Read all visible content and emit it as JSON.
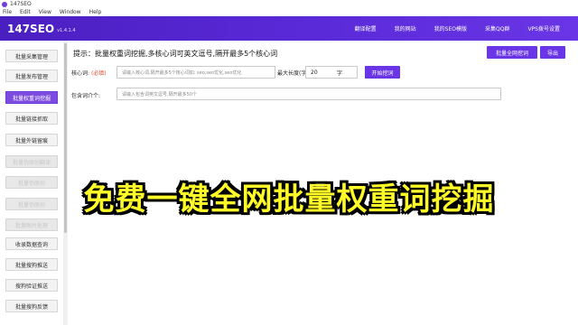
{
  "window": {
    "title": "147SEO"
  },
  "menu": [
    "File",
    "Edit",
    "View",
    "Window",
    "Help"
  ],
  "header": {
    "brand": "147SEO",
    "version": "v1.4.1.4",
    "nav": [
      "翻译配置",
      "我的网站",
      "我的SEO模版",
      "采集QQ群",
      "VPS拨号设置"
    ]
  },
  "sidebar": {
    "items": [
      {
        "label": "批量采集管理",
        "state": "normal"
      },
      {
        "label": "批量发布管理",
        "state": "normal"
      },
      {
        "label": "批量权重词挖掘",
        "state": "active"
      },
      {
        "label": "批量链接抓取",
        "state": "normal"
      },
      {
        "label": "批量外链留痕",
        "state": "normal"
      },
      {
        "label": "批量伪原创翻译",
        "state": "disabled"
      },
      {
        "label": "批量伪原创",
        "state": "disabled"
      },
      {
        "label": "批量伪原创",
        "state": "disabled"
      },
      {
        "label": "批量图片处理",
        "state": "disabled"
      },
      {
        "label": "收录数据查询",
        "state": "normal"
      },
      {
        "label": "批量搜狗推送",
        "state": "normal"
      },
      {
        "label": "搜狗验证推送",
        "state": "normal"
      },
      {
        "label": "批量搜狗反馈",
        "state": "normal"
      }
    ]
  },
  "main": {
    "tip": "提示：批量权重词挖掘,多核心词可英文逗号,隔开最多5个核心词",
    "export_all_label": "批量全网挖词",
    "export_label": "导出",
    "core_word_label": "核心词:",
    "required_mark": "(必填)",
    "core_word_placeholder": "请输入核心词,隔开最多5个核心词如: seo,seo优化,seo优化",
    "max_length_label": "最大长度(字):",
    "max_length_value": "20",
    "max_length_unit": "字",
    "start_button": "开始挖词",
    "include_label": "包含词介个:",
    "include_placeholder": "请输入包含词英文逗号,隔开最多50个"
  },
  "banner": {
    "text": "免费一键全网批量权重词挖掘"
  }
}
